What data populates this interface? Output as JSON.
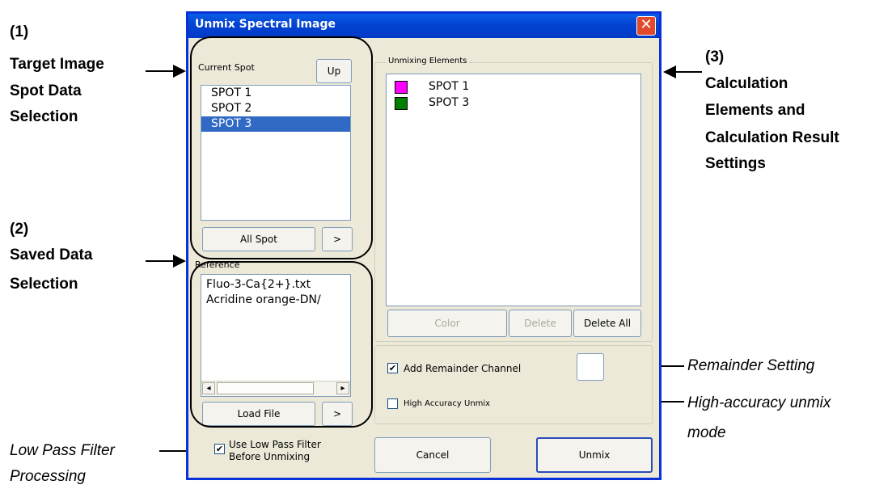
{
  "annotations": {
    "a1_number": "(1)",
    "a1_line1": "Target Image",
    "a1_line2": "Spot Data",
    "a1_line3": "Selection",
    "a2_number": "(2)",
    "a2_line1": "Saved Data",
    "a2_line2": "Selection",
    "a3_number": "(3)",
    "a3_line1": "Calculation",
    "a3_line2": "Elements and",
    "a3_line3": "Calculation Result",
    "a3_line4": "Settings",
    "remainder": "Remainder Setting",
    "high_accuracy_line1": "High-accuracy unmix",
    "high_accuracy_line2": "mode",
    "low_pass_line1": "Low Pass Filter",
    "low_pass_line2": "Processing"
  },
  "window": {
    "title": "Unmix Spectral Image",
    "close_glyph": "✕"
  },
  "current_spot": {
    "label": "Current Spot",
    "up_button": "Up",
    "items": [
      "SPOT   1",
      "SPOT   2",
      "SPOT   3"
    ],
    "selected_index": 2,
    "all_spot_button": "All Spot",
    "arrow_button": ">"
  },
  "reference": {
    "label": "Reference",
    "items": [
      "Fluo-3-Ca{2+}.txt",
      "Acridine orange-DN/"
    ],
    "scroll_left": "◂",
    "scroll_right": "▸",
    "load_file_button": "Load File",
    "arrow_button": ">"
  },
  "unmixing": {
    "label": "Unmixing Elements",
    "items": [
      {
        "name": "SPOT   1",
        "color": "#ff00ff"
      },
      {
        "name": "SPOT   3",
        "color": "#008000"
      }
    ],
    "color_button": "Color",
    "delete_button": "Delete",
    "delete_all_button": "Delete All"
  },
  "options": {
    "add_remainder_label": "Add Remainder Channel",
    "add_remainder_checked": true,
    "remainder_color": "#ffffff",
    "high_accuracy_label": "High Accuracy Unmix",
    "high_accuracy_checked": false,
    "low_pass_line1": "Use Low Pass Filter",
    "low_pass_line2": "Before Unmixing",
    "low_pass_checked": true,
    "check_glyph": "✔"
  },
  "footer": {
    "cancel_button": "Cancel",
    "unmix_button": "Unmix"
  }
}
